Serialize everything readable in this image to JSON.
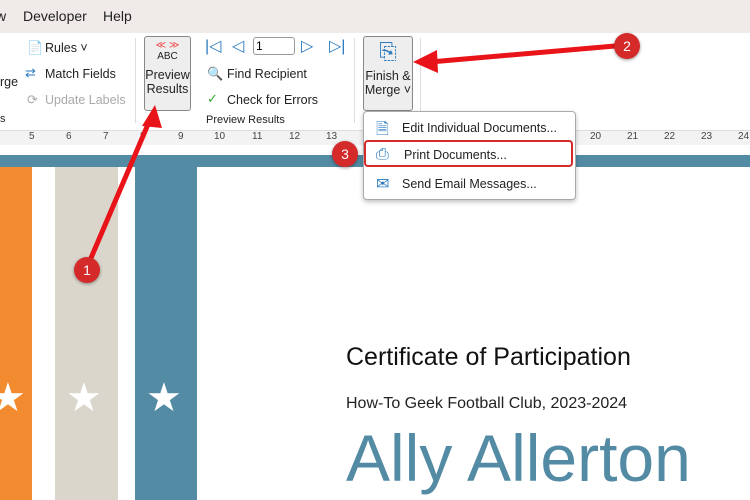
{
  "menubar": {
    "items": [
      "w",
      "Developer",
      "Help"
    ]
  },
  "ribbon": {
    "merge_partial": "rge",
    "group_partial": "s",
    "rules": "Rules ˅",
    "match_fields": "Match Fields",
    "update_labels": "Update Labels",
    "preview_abc": "ABC",
    "preview_line1": "Preview",
    "preview_line2": "Results",
    "record_number": "1",
    "find_recipient": "Find Recipient",
    "check_errors": "Check for Errors",
    "preview_group": "Preview Results",
    "finish_line1": "Finish &",
    "finish_line2": "Merge ˅"
  },
  "ruler": [
    "5",
    "6",
    "7",
    "8",
    "9",
    "10",
    "11",
    "12",
    "13",
    "20",
    "21",
    "22",
    "23",
    "24"
  ],
  "dropdown": {
    "items": [
      "Edit Individual Documents...",
      "Print Documents...",
      "Send Email Messages..."
    ]
  },
  "annotations": [
    "1",
    "2",
    "3"
  ],
  "certificate": {
    "title": "Certificate of Participation",
    "subtitle": "How-To Geek Football Club, 2023-2024",
    "name": "Ally Allerton"
  },
  "colors": {
    "orange": "#f28b30",
    "beige": "#dad6cc",
    "teal": "#538aa4",
    "annotation": "#d42a2a"
  }
}
